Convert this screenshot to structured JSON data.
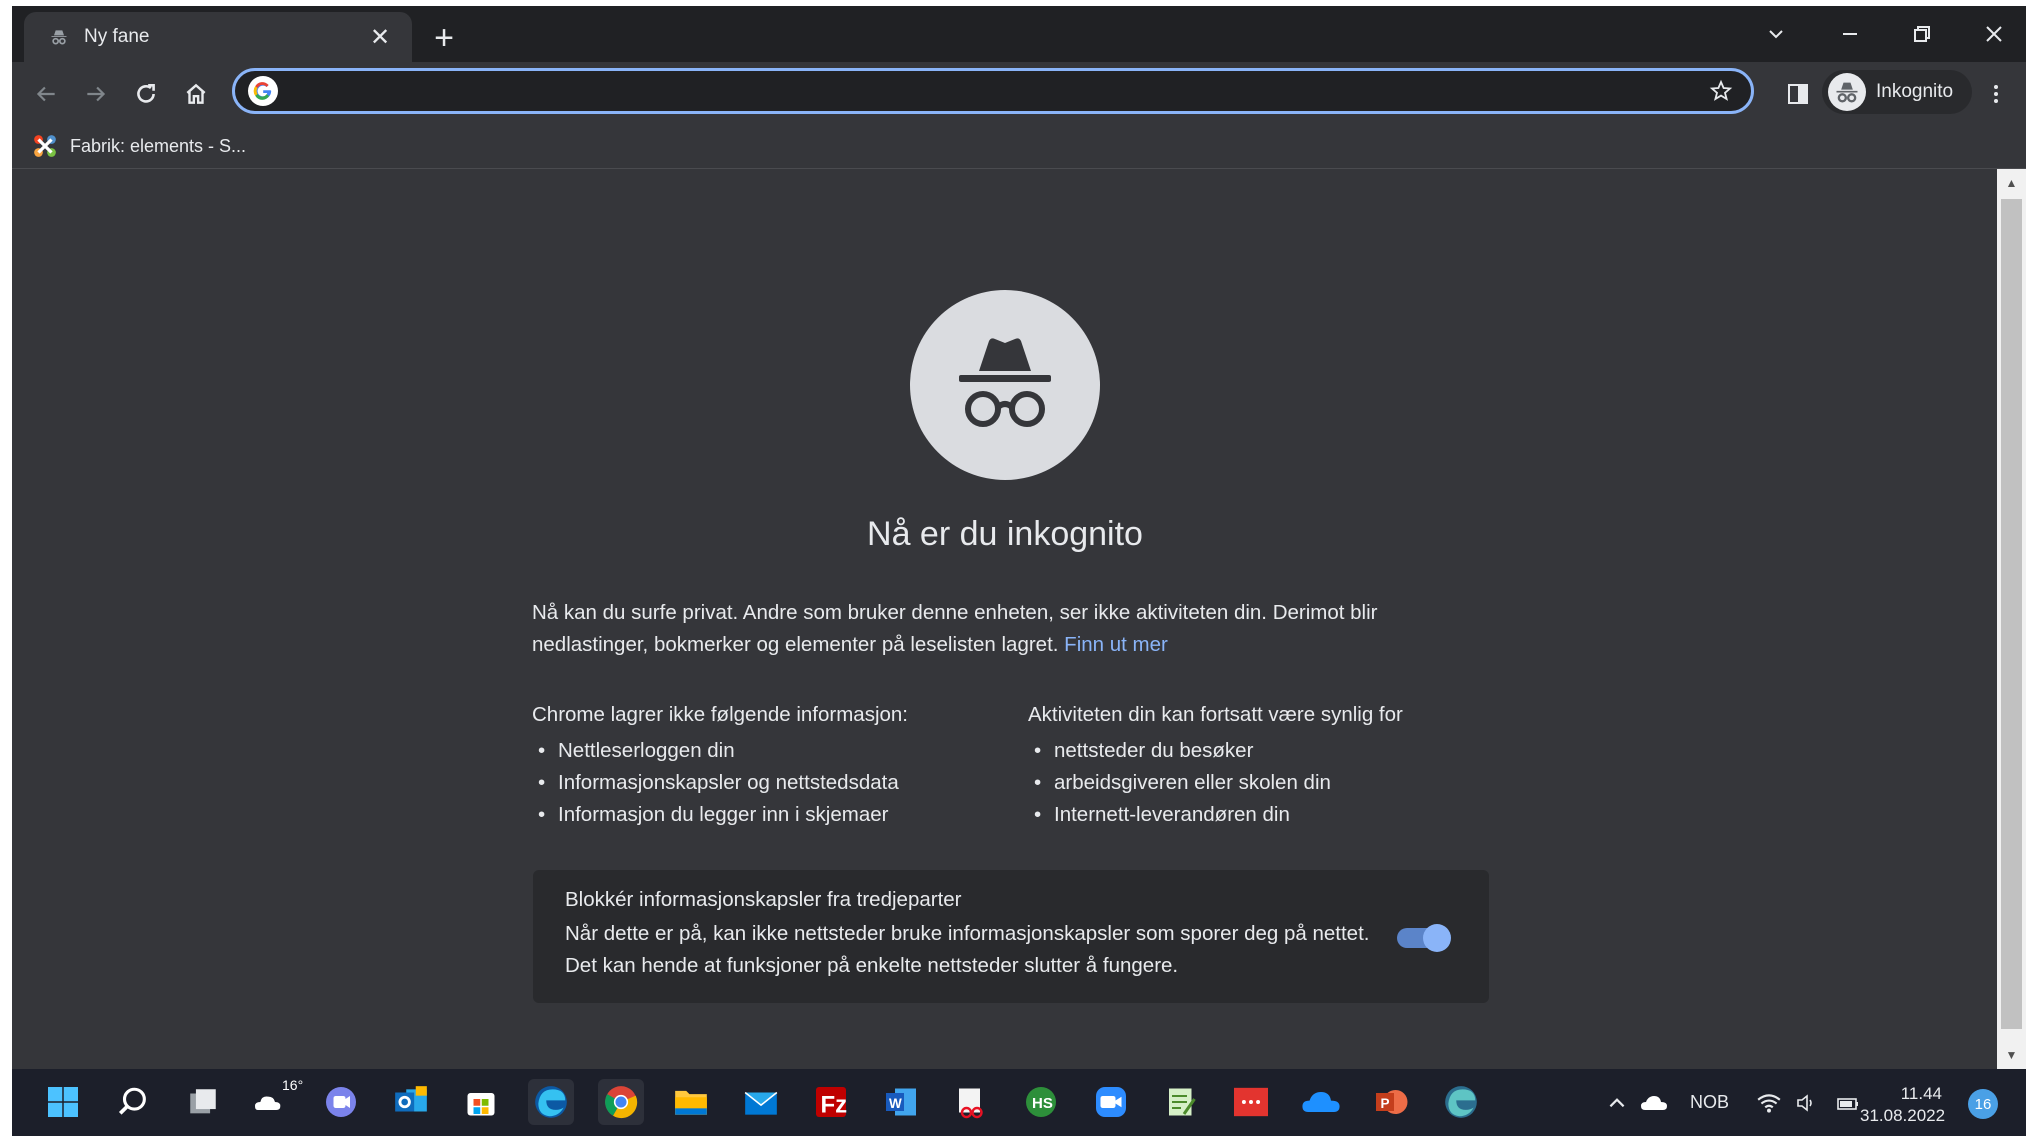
{
  "tab": {
    "title": "Ny fane"
  },
  "toolbar": {
    "address_value": "",
    "profile_label": "Inkognito"
  },
  "bookmarks": {
    "items": [
      {
        "label": "Fabrik: elements - S..."
      }
    ]
  },
  "page": {
    "heading": "Nå er du inkognito",
    "intro": "Nå kan du surfe privat. Andre som bruker denne enheten, ser ikke aktiviteten din. Derimot blir nedlastinger, bokmerker og elementer på leselisten lagret.",
    "learn_more": "Finn ut mer",
    "left_heading": "Chrome lagrer ikke følgende informasjon:",
    "left_items": [
      "Nettleserloggen din",
      "Informasjonskapsler og nettstedsdata",
      "Informasjon du legger inn i skjemaer"
    ],
    "right_heading": "Aktiviteten din kan fortsatt være synlig for",
    "right_items": [
      "nettsteder du besøker",
      "arbeidsgiveren eller skolen din",
      "Internett-leverandøren din"
    ],
    "cookie_title": "Blokkér informasjonskapsler fra tredjeparter",
    "cookie_desc": "Når dette er på, kan ikke nettsteder bruke informasjonskapsler som sporer deg på nettet. Det kan hende at funksjoner på enkelte nettsteder slutter å fungere.",
    "cookie_toggle_on": true
  },
  "taskbar": {
    "weather_temp": "16°",
    "language": "NOB",
    "time": "11.44",
    "date": "31.08.2022",
    "notification_count": "16",
    "icons": [
      "start-icon",
      "search-icon",
      "task-view-icon",
      "weather-icon",
      "teams-chat-icon",
      "outlook-icon",
      "store-icon",
      "edge-icon",
      "chrome-icon",
      "file-explorer-icon",
      "mail-icon",
      "filezilla-icon",
      "word-icon",
      "snipping-tool-icon",
      "hubspot-icon",
      "zoom-icon",
      "notepad-icon",
      "app-red-icon",
      "onedrive-icon",
      "powerpoint-icon",
      "edge-dev-icon"
    ]
  },
  "colors": {
    "accent": "#8ab4f8",
    "background": "#35363a",
    "tab_strip": "#202124",
    "taskbar": "#1c1f2a"
  }
}
